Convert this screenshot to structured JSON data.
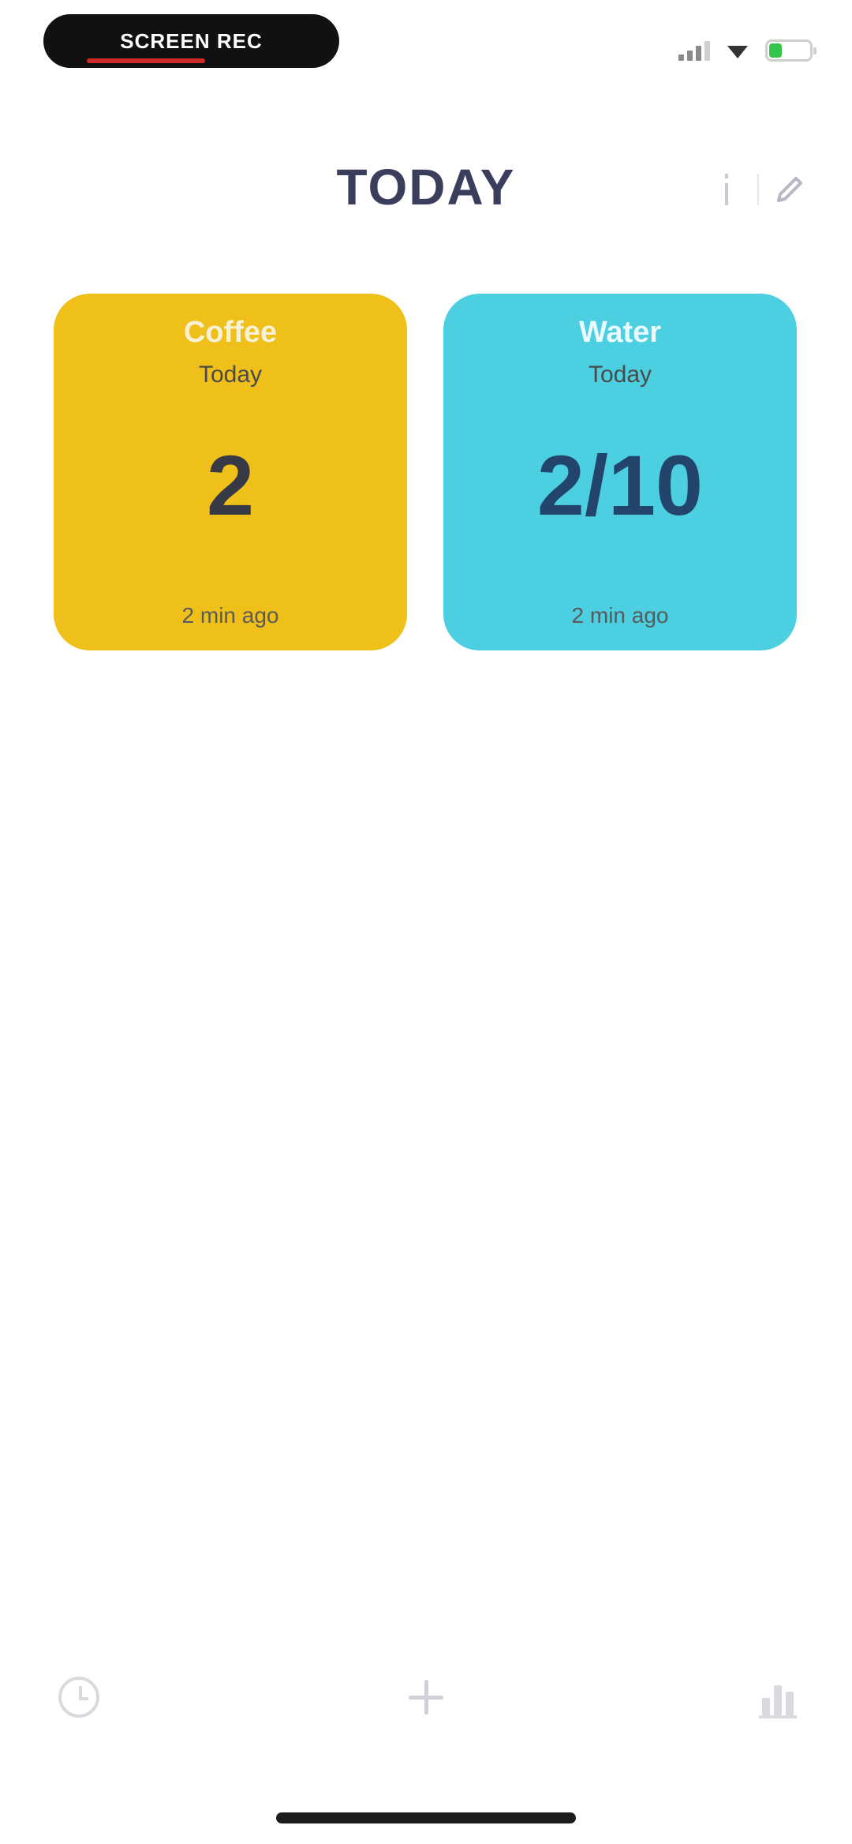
{
  "status_bar": {
    "recording_label": "SCREEN REC",
    "signal_icon": "cellular-signal-icon",
    "wifi_icon": "wifi-icon",
    "battery_icon": "battery-icon"
  },
  "header": {
    "title": "TODAY",
    "info_icon": "info-icon",
    "edit_icon": "edit-icon"
  },
  "cards": [
    {
      "name": "Coffee",
      "subtitle": "Today",
      "value": "2",
      "time_ago": "2 min ago",
      "color": "#f0c01a"
    },
    {
      "name": "Water",
      "subtitle": "Today",
      "value": "2/10",
      "time_ago": "2 min ago",
      "color": "#4bcfe1"
    }
  ],
  "bottom_nav": {
    "history_icon": "history-icon",
    "add_icon": "plus-icon",
    "stats_icon": "stats-icon"
  }
}
